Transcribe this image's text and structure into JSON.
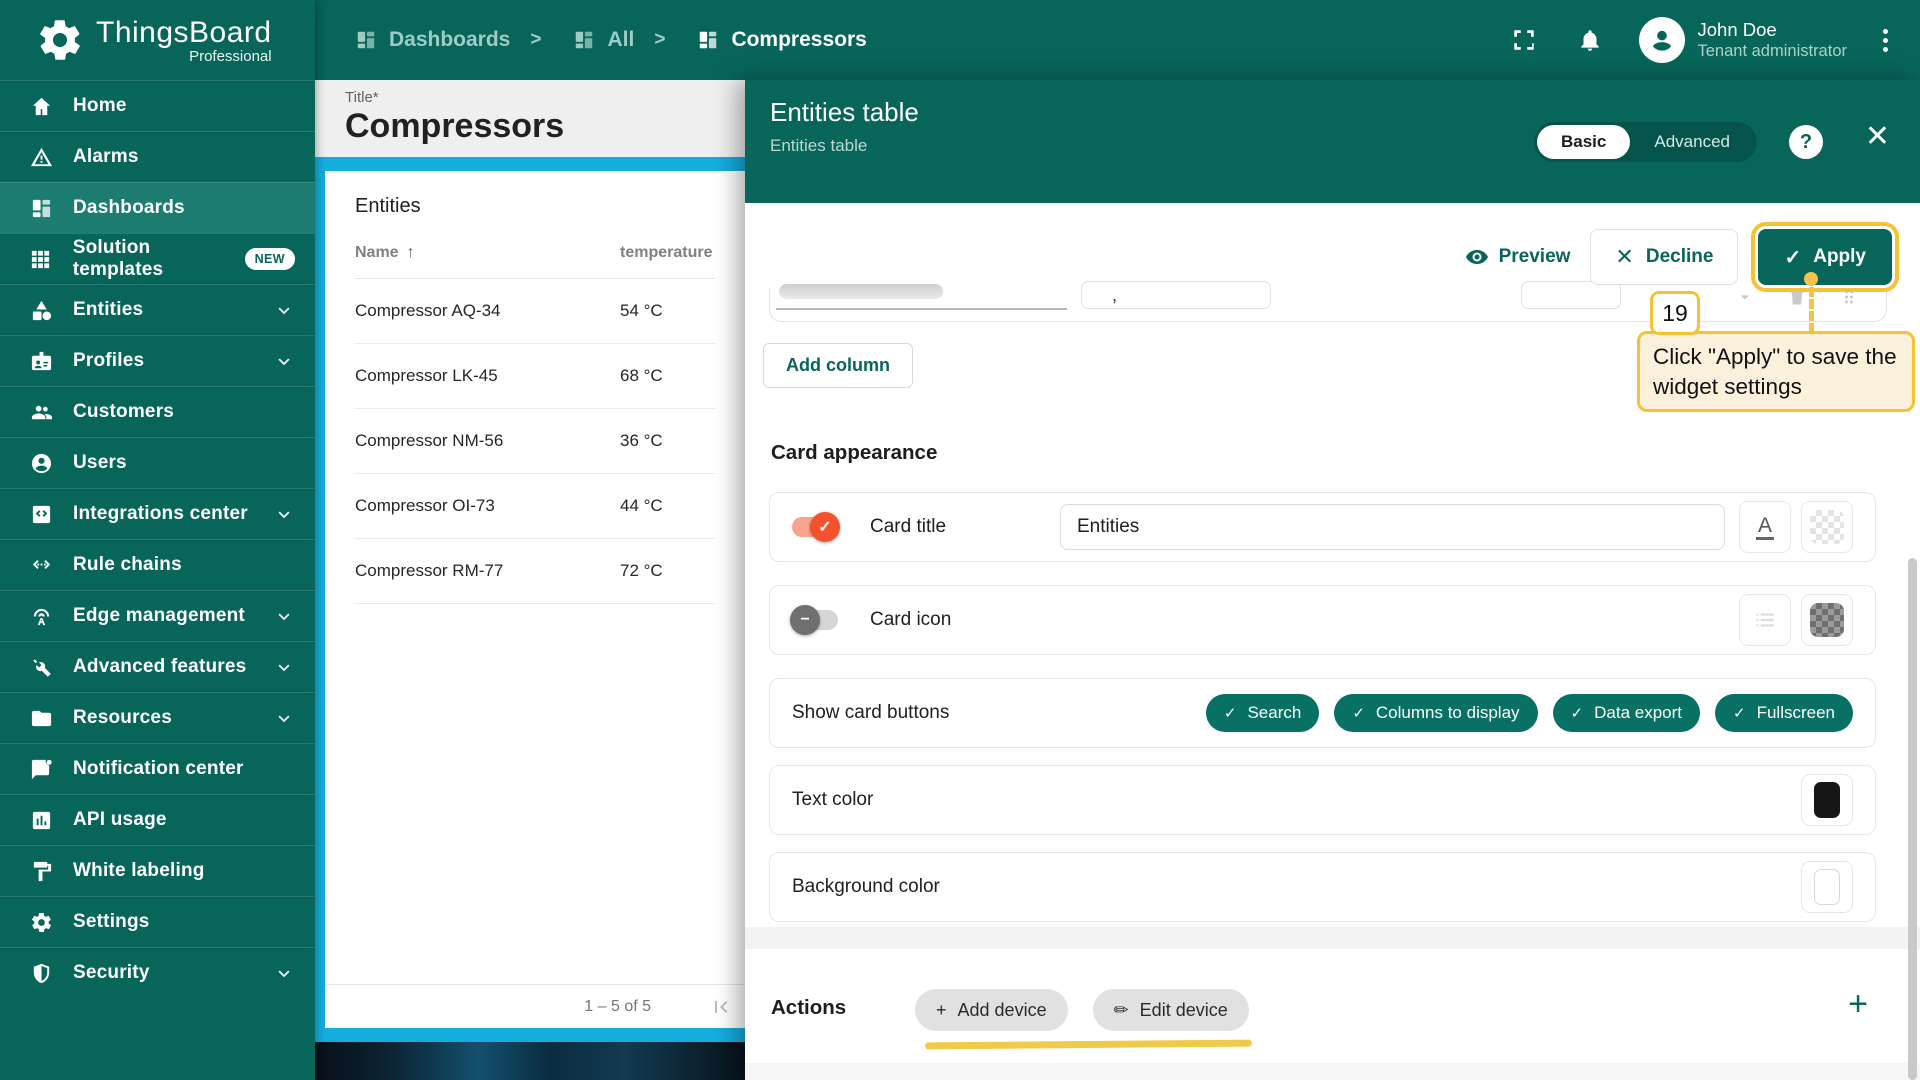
{
  "brand": {
    "name": "ThingsBoard",
    "tier": "Professional"
  },
  "sidebar": {
    "items": [
      {
        "label": "Home",
        "icon": "home"
      },
      {
        "label": "Alarms",
        "icon": "alarm"
      },
      {
        "label": "Dashboards",
        "icon": "dashboard",
        "active": true
      },
      {
        "label": "Solution templates",
        "icon": "apps",
        "badge": "NEW"
      },
      {
        "label": "Entities",
        "icon": "category",
        "chevron": true
      },
      {
        "label": "Profiles",
        "icon": "idbadge",
        "chevron": true
      },
      {
        "label": "Customers",
        "icon": "people"
      },
      {
        "label": "Users",
        "icon": "account"
      },
      {
        "label": "Integrations center",
        "icon": "integration",
        "chevron": true
      },
      {
        "label": "Rule chains",
        "icon": "rulechain"
      },
      {
        "label": "Edge management",
        "icon": "edge",
        "chevron": true
      },
      {
        "label": "Advanced features",
        "icon": "tools",
        "chevron": true
      },
      {
        "label": "Resources",
        "icon": "folder",
        "chevron": true
      },
      {
        "label": "Notification center",
        "icon": "notification"
      },
      {
        "label": "API usage",
        "icon": "api"
      },
      {
        "label": "White labeling",
        "icon": "whitelabel"
      },
      {
        "label": "Settings",
        "icon": "settings"
      },
      {
        "label": "Security",
        "icon": "security",
        "chevron": true
      }
    ]
  },
  "header": {
    "breadcrumbs": [
      {
        "label": "Dashboards",
        "icon": "dashboard"
      },
      {
        "label": "All",
        "icon": "dashboard",
        "sep": ">"
      },
      {
        "label": "Compressors",
        "icon": "dashboard",
        "sep": ">",
        "active": true
      }
    ],
    "user": {
      "name": "John Doe",
      "role": "Tenant administrator"
    }
  },
  "editor": {
    "title_label": "Title*",
    "title_value": "Compressors"
  },
  "widget": {
    "card_title": "Entities",
    "name_col": "Name",
    "temp_col": "temperature",
    "rows": [
      {
        "name": "Compressor AQ-34",
        "temp": "54 °C"
      },
      {
        "name": "Compressor LK-45",
        "temp": "68 °C"
      },
      {
        "name": "Compressor NM-56",
        "temp": "36 °C"
      },
      {
        "name": "Compressor OI-73",
        "temp": "44 °C"
      },
      {
        "name": "Compressor RM-77",
        "temp": "72 °C"
      }
    ],
    "pagination": "1 – 5 of 5"
  },
  "panel": {
    "title": "Entities table",
    "subtitle": "Entities table",
    "tabs": [
      {
        "label": "Basic"
      },
      {
        "label": "Advanced"
      }
    ],
    "toolbar": {
      "preview": "Preview",
      "decline": "Decline",
      "apply": "Apply"
    },
    "columns_editor": {
      "add_column": "Add column",
      "partial_text": ","
    },
    "tutorial": {
      "step": "19",
      "text": "Click \"Apply\" to save the widget settings"
    },
    "card_appearance": {
      "heading": "Card appearance",
      "card_title_label": "Card title",
      "card_title_value": "Entities",
      "card_icon_label": "Card icon",
      "show_card_buttons_label": "Show card buttons",
      "buttons": [
        {
          "label": "Search"
        },
        {
          "label": "Columns to display"
        },
        {
          "label": "Data export"
        },
        {
          "label": "Fullscreen"
        }
      ],
      "text_color_label": "Text color",
      "background_color_label": "Background color"
    },
    "actions": {
      "heading": "Actions",
      "chips": [
        {
          "label": "Add device",
          "glyph": "+"
        },
        {
          "label": "Edit device",
          "glyph": "✏"
        }
      ]
    }
  },
  "colors": {
    "teal": "#07655A",
    "active_nav": "#1B7C6F",
    "widget_selection_cyan": "#15ACDE",
    "toggle_on": "#F4512C",
    "tutorial_yellow": "#F5C235",
    "marker_yellow": "#EFC53A",
    "text_color_swatch": "#161616"
  }
}
